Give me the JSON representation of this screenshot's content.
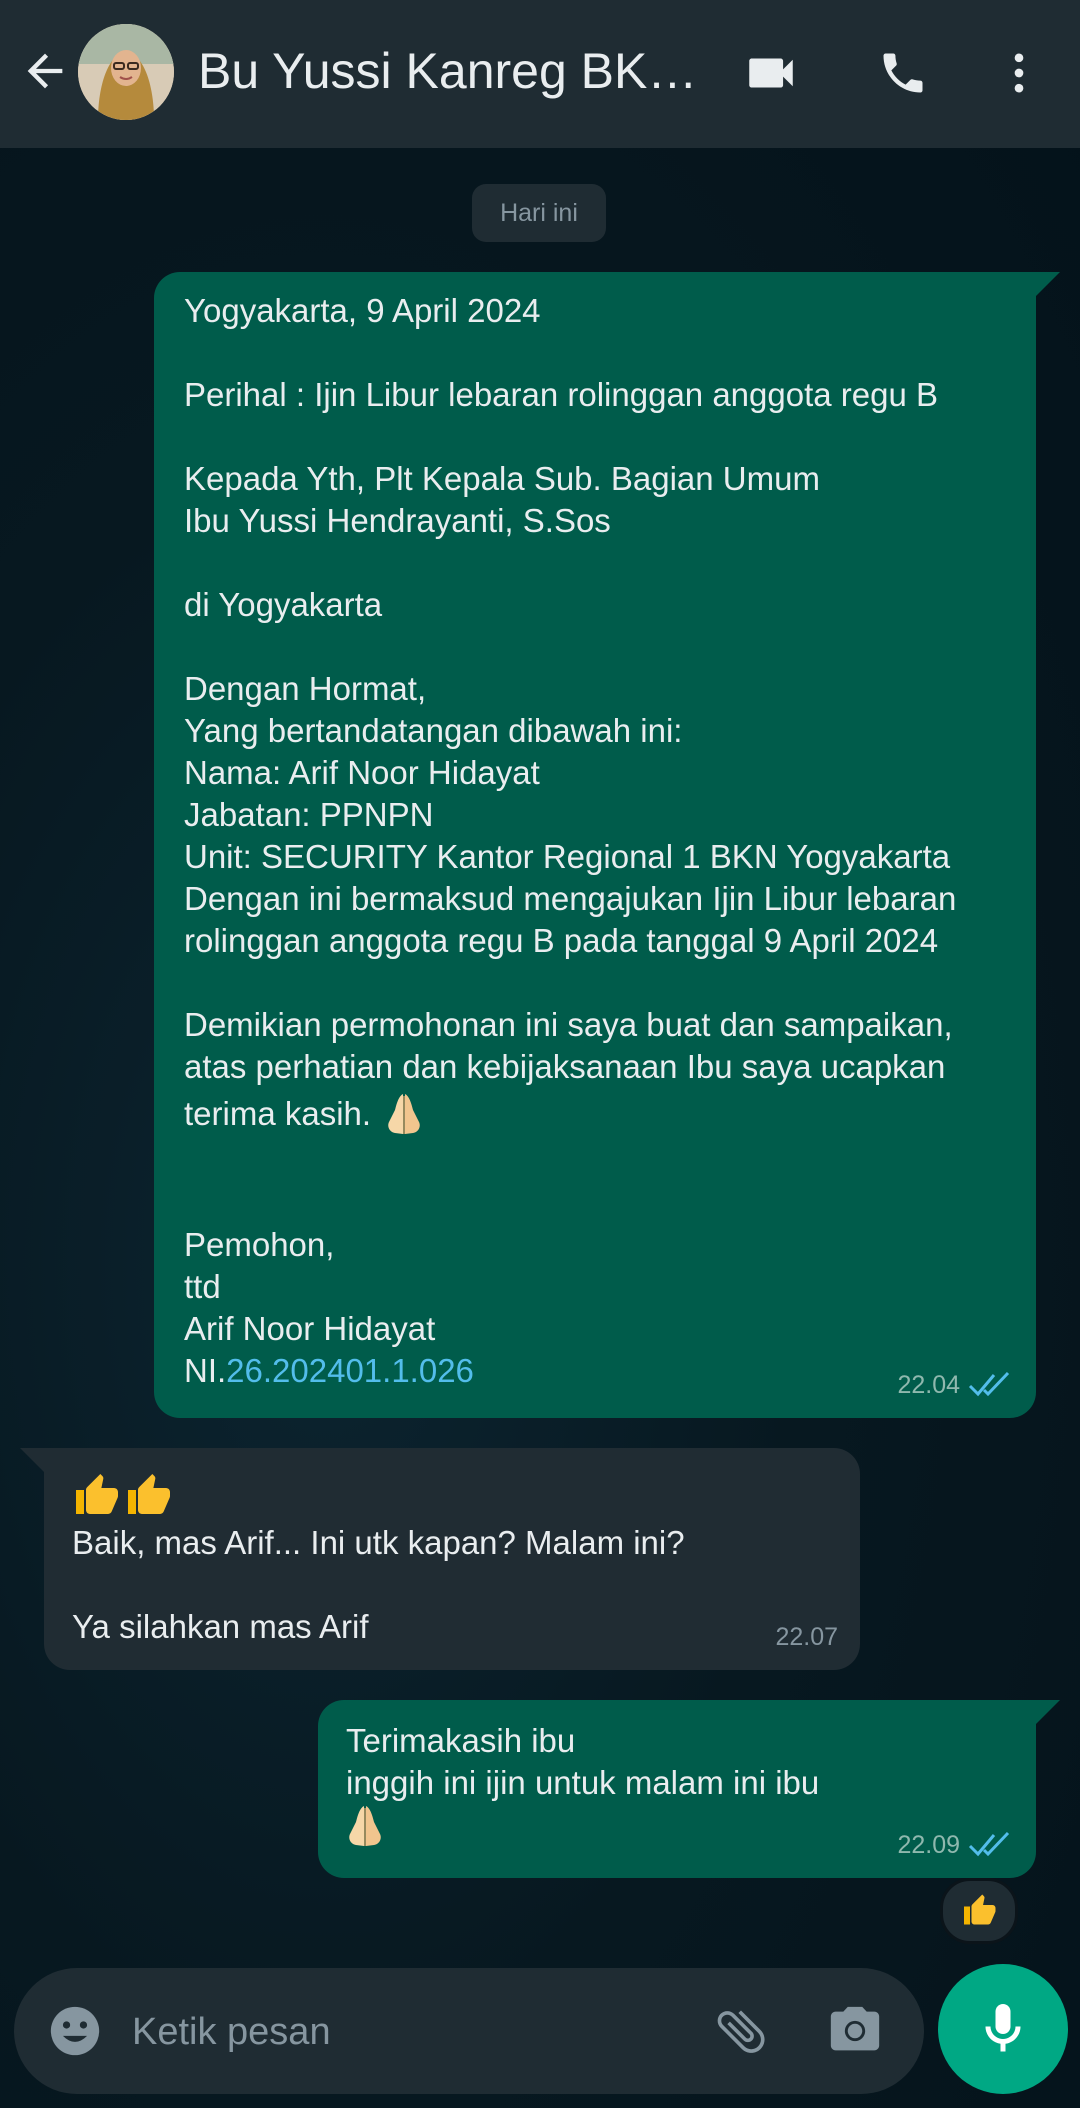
{
  "header": {
    "contact_name": "Bu Yussi Kanreg BKN...",
    "icons": [
      "arrow-back-icon",
      "avatar",
      "videocam-icon",
      "phone-icon",
      "more-vert-icon"
    ]
  },
  "date_chip": "Hari ini",
  "messages": [
    {
      "direction": "outgoing",
      "lines": {
        "l1": "Yogyakarta, 9 April 2024",
        "l2": "Perihal : Ijin Libur lebaran rolinggan anggota regu B",
        "l3": "Kepada Yth, Plt Kepala Sub. Bagian Umum",
        "l4": "Ibu Yussi Hendrayanti, S.Sos",
        "l5": "di Yogyakarta",
        "l6": "Dengan Hormat,",
        "l7": "Yang bertandatangan dibawah ini:",
        "l8": "Nama: Arif Noor Hidayat",
        "l9": "Jabatan: PPNPN",
        "l10": "Unit: SECURITY Kantor Regional 1 BKN Yogyakarta",
        "l11": "Dengan ini bermaksud mengajukan Ijin Libur lebaran",
        "l12": "rolinggan anggota regu B pada tanggal 9 April 2024",
        "l13": "Demikian permohonan ini saya buat dan sampaikan,",
        "l14": "atas perhatian dan kebijaksanaan Ibu saya ucapkan",
        "l15": "terima kasih.",
        "l16": "Pemohon,",
        "l17": "ttd",
        "l18": "Arif Noor Hidayat",
        "l19_prefix": "NI.",
        "l19_link": "26.202401.1.026"
      },
      "time": "22.04",
      "status": "read"
    },
    {
      "direction": "incoming",
      "lines": {
        "l1": "Baik, mas Arif... Ini utk kapan? Malam ini?",
        "l2": "Ya silahkan mas Arif"
      },
      "time": "22.07"
    },
    {
      "direction": "outgoing",
      "lines": {
        "l1": "Terimakasih ibu",
        "l2": "inggih ini ijin untuk malam ini ibu"
      },
      "time": "22.09",
      "status": "read",
      "reaction": "thumbs-up"
    }
  ],
  "composer": {
    "placeholder": "Ketik pesan"
  },
  "colors": {
    "header_bg": "#1f2c33",
    "outgoing_bubble": "#005c4b",
    "incoming_bubble": "#202c33",
    "link": "#53bdeb",
    "read_ticks": "#53bdeb",
    "mic_button": "#00a884"
  }
}
